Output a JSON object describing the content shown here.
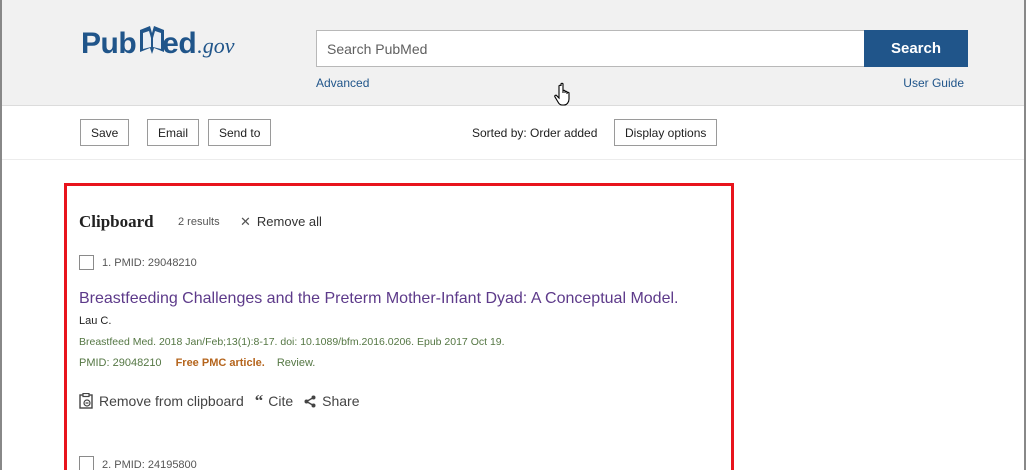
{
  "header": {
    "logo": {
      "pub": "Pub",
      "med": "ed",
      "gov": ".gov"
    },
    "search_placeholder": "Search PubMed",
    "search_button": "Search",
    "advanced_link": "Advanced",
    "user_guide_link": "User Guide"
  },
  "toolbar": {
    "save": "Save",
    "email": "Email",
    "send_to": "Send to",
    "sorted_by": "Sorted by: Order added",
    "display_options": "Display options"
  },
  "clipboard": {
    "title": "Clipboard",
    "count": "2 results",
    "remove_all": "Remove all",
    "results": [
      {
        "number": "1. PMID: 29048210",
        "title": "Breastfeeding Challenges and the Preterm Mother-Infant Dyad: A Conceptual Model.",
        "authors": "Lau C.",
        "citation": "Breastfeed Med. 2018 Jan/Feb;13(1):8-17. doi: 10.1089/bfm.2016.0206. Epub 2017 Oct 19.",
        "pmid": "PMID: 29048210",
        "free_pmc": "Free PMC article.",
        "type": "Review.",
        "actions": {
          "remove": "Remove from clipboard",
          "cite": "Cite",
          "share": "Share"
        }
      },
      {
        "number": "2. PMID: 24195800"
      }
    ]
  },
  "colors": {
    "brand": "#20558a",
    "highlight_border": "#e8141c",
    "title_link": "#5d3a8a",
    "journal_green": "#557744",
    "free_pmc": "#b5651d"
  },
  "icons": {
    "cursor": "hand-pointer-icon",
    "remove": "clipboard-remove-icon",
    "cite": "quote-icon",
    "share": "share-icon",
    "close": "close-icon"
  }
}
